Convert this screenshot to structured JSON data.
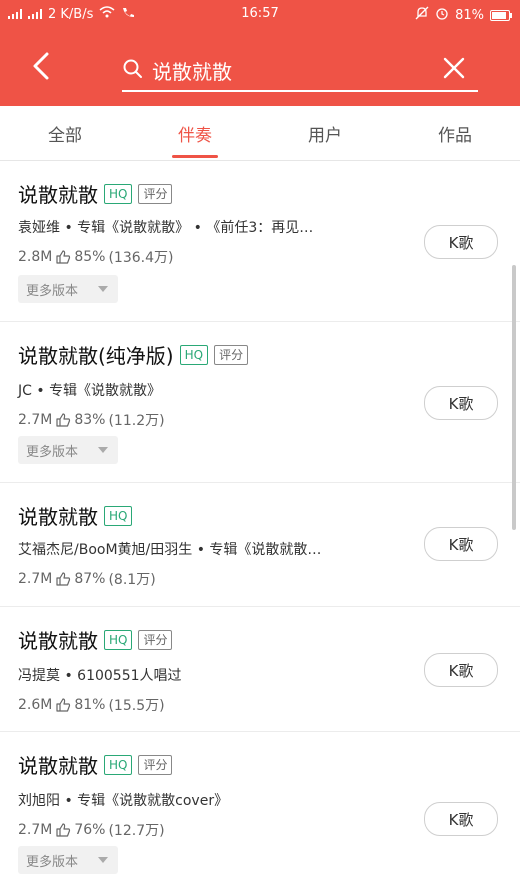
{
  "status_bar": {
    "left_text": "2 K/B/s",
    "time": "16:57",
    "battery": "81%"
  },
  "search": {
    "value": "说散就散",
    "placeholder": ""
  },
  "tabs": [
    {
      "label": "全部",
      "active": false
    },
    {
      "label": "伴奏",
      "active": true
    },
    {
      "label": "用户",
      "active": false
    },
    {
      "label": "作品",
      "active": false
    }
  ],
  "results": [
    {
      "title": "说散就散",
      "hq": "HQ",
      "score": "评分",
      "meta": "袁娅维 • 专辑《说散就散》 • 《前任3：再见…",
      "size": "2.8M",
      "rating": "85%",
      "count": "(136.4万)",
      "more_versions": "更多版本",
      "k_label": "K歌"
    },
    {
      "title": "说散就散(纯净版)",
      "hq": "HQ",
      "score": "评分",
      "meta": "JC • 专辑《说散就散》",
      "size": "2.7M",
      "rating": "83%",
      "count": "(11.2万)",
      "more_versions": "更多版本",
      "k_label": "K歌"
    },
    {
      "title": "说散就散",
      "hq": "HQ",
      "score": "",
      "meta": "艾福杰尼/BooM黄旭/田羽生 • 专辑《说散就散…",
      "size": "2.7M",
      "rating": "87%",
      "count": "(8.1万)",
      "more_versions": "",
      "k_label": "K歌"
    },
    {
      "title": "说散就散",
      "hq": "HQ",
      "score": "评分",
      "meta": "冯提莫 • 6100551人唱过",
      "size": "2.6M",
      "rating": "81%",
      "count": "(15.5万)",
      "more_versions": "",
      "k_label": "K歌"
    },
    {
      "title": "说散就散",
      "hq": "HQ",
      "score": "评分",
      "meta": "刘旭阳 • 专辑《说散就散cover》",
      "size": "2.7M",
      "rating": "76%",
      "count": "(12.7万)",
      "more_versions": "更多版本",
      "k_label": "K歌"
    }
  ],
  "colors": {
    "accent": "#ef5346",
    "hq_badge": "#2aa876"
  }
}
